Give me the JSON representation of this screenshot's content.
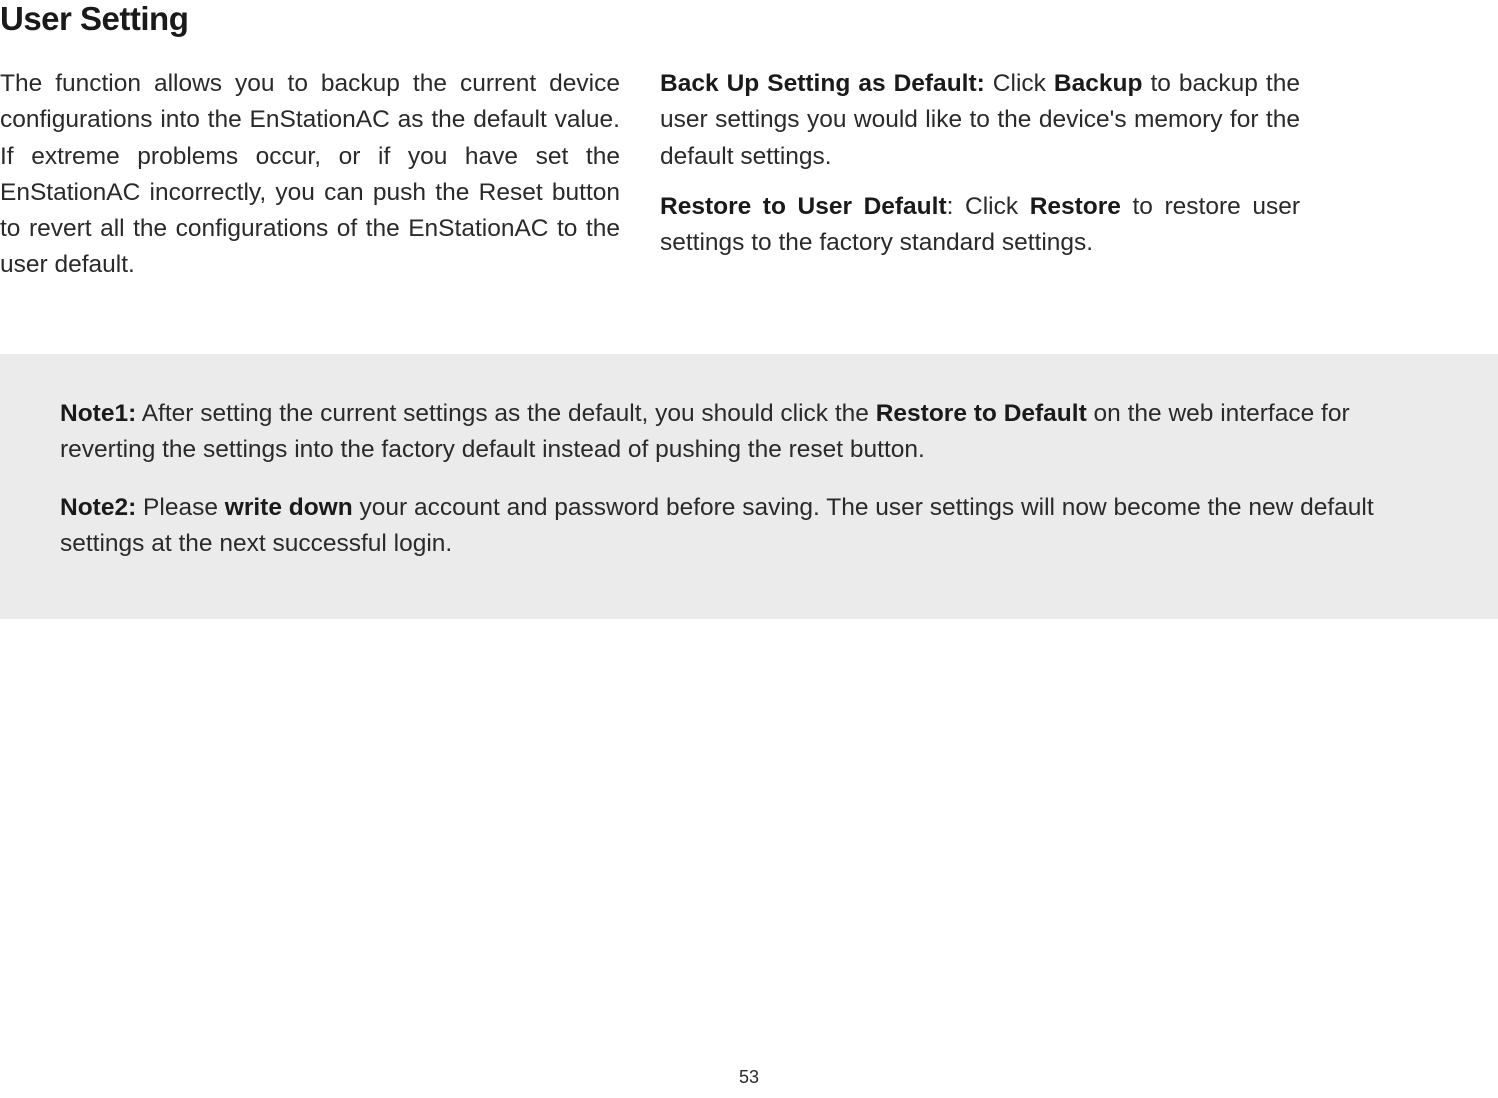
{
  "title": "User Setting",
  "leftParagraph": "The function allows you to backup the current device configurations into the EnStationAC as the default value. If extreme problems occur, or if you have set the EnStationAC incorrectly, you can push the Reset button to revert all the configurations of the EnStationAC to the user default.",
  "right": {
    "para1": {
      "boldLead": "Back Up Setting as Default:",
      "mid": "  Click ",
      "boldWord": "Backup",
      "rest": " to backup the user settings you would like to the device's memory for the default settings."
    },
    "para2": {
      "boldLead": "Restore to User Default",
      "mid": ": Click ",
      "boldWord": "Restore",
      "rest": " to restore user settings to the factory standard settings."
    }
  },
  "notes": {
    "note1": {
      "label": "Note1:",
      "text1": " After setting the current settings as the default, you should click the ",
      "bold1": "Restore to Default",
      "text2": " on the web interface for reverting the settings into the factory default instead of pushing the reset button."
    },
    "note2": {
      "label": "Note2:",
      "text1": " Please ",
      "bold1": "write down",
      "text2": " your account and password before saving. The user settings will now become the new default settings at the next successful login."
    }
  },
  "pageNumber": "53"
}
